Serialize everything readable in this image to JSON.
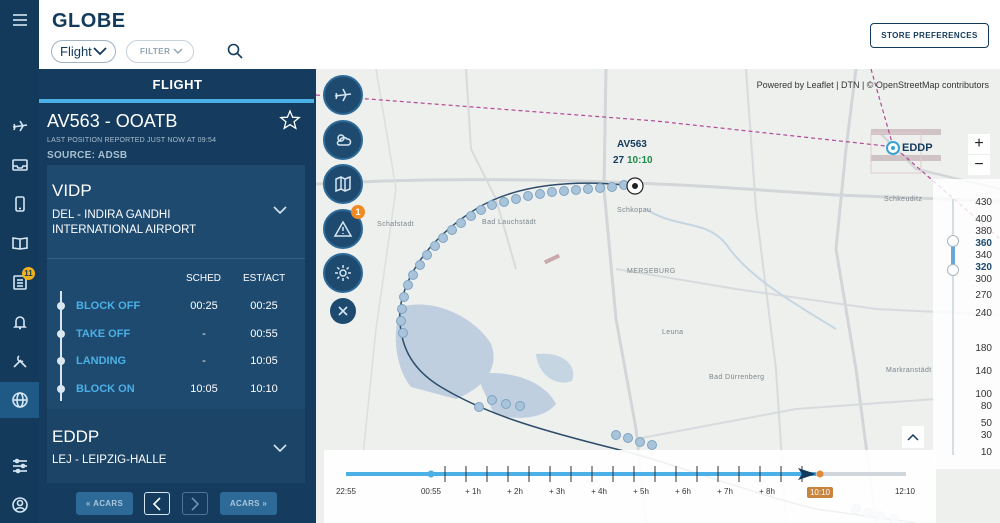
{
  "header": {
    "title": "GLOBE",
    "view_select": "Flight",
    "filter_label": "FILTER",
    "store_button": "STORE PREFERENCES"
  },
  "rail": {
    "items": [
      {
        "icon": "menu-icon"
      },
      {
        "icon": "plane-icon"
      },
      {
        "icon": "inbox-icon"
      },
      {
        "icon": "tablet-icon"
      },
      {
        "icon": "book-icon"
      },
      {
        "icon": "checklist-icon",
        "badge": "11"
      },
      {
        "icon": "bell-icon"
      },
      {
        "icon": "tools-icon"
      },
      {
        "icon": "globe-icon",
        "active": true
      },
      {
        "icon": "sliders-icon"
      },
      {
        "icon": "user-icon"
      }
    ]
  },
  "panel": {
    "tab": "FLIGHT",
    "flight_id": "AV563 - OOATB",
    "last_position": "LAST POSITION REPORTED JUST NOW AT 09:54",
    "source": "SOURCE: ADSB",
    "origin": {
      "code": "VIDP",
      "name": "DEL - INDIRA GANDHI INTERNATIONAL AIRPORT"
    },
    "destination": {
      "code": "EDDP",
      "name": "LEJ - LEIPZIG-HALLE"
    },
    "table_headers": {
      "sched": "SCHED",
      "est": "EST/ACT"
    },
    "events": [
      {
        "label": "BLOCK OFF",
        "sched": "00:25",
        "est": "00:25"
      },
      {
        "label": "TAKE OFF",
        "sched": "-",
        "est": "00:55"
      },
      {
        "label": "LANDING",
        "sched": "-",
        "est": "10:05"
      },
      {
        "label": "BLOCK ON",
        "sched": "10:05",
        "est": "10:10"
      }
    ],
    "acars_prev": "ACARS",
    "acars_next": "ACARS"
  },
  "map": {
    "attribution": "Powered by Leaflet | DTN | © OpenStreetMap contributors",
    "aircraft_label": "AV563",
    "aircraft_alt": "27",
    "aircraft_time": "10:10",
    "airport_label": "EDDP",
    "alert_badge": "1",
    "towns": [
      "Schafstadt",
      "Bad Lauchstädt",
      "Schkopau",
      "MERSEBURG",
      "Leuna",
      "Bad Dürrenberg",
      "Markranstädt",
      "Schkeuditz"
    ],
    "altitudes": [
      "430",
      "400",
      "380",
      "360",
      "340",
      "320",
      "300",
      "270",
      "240",
      "180",
      "140",
      "100",
      "80",
      "50",
      "30",
      "10"
    ],
    "altitude_selected": [
      "360",
      "320"
    ]
  },
  "timeline": {
    "labels": [
      "22:55",
      "00:55",
      "+ 1h",
      "+ 2h",
      "+ 3h",
      "+ 4h",
      "+ 5h",
      "+ 6h",
      "+ 7h",
      "+ 8h",
      "10:10",
      "12:10"
    ],
    "current": "10:10"
  }
}
